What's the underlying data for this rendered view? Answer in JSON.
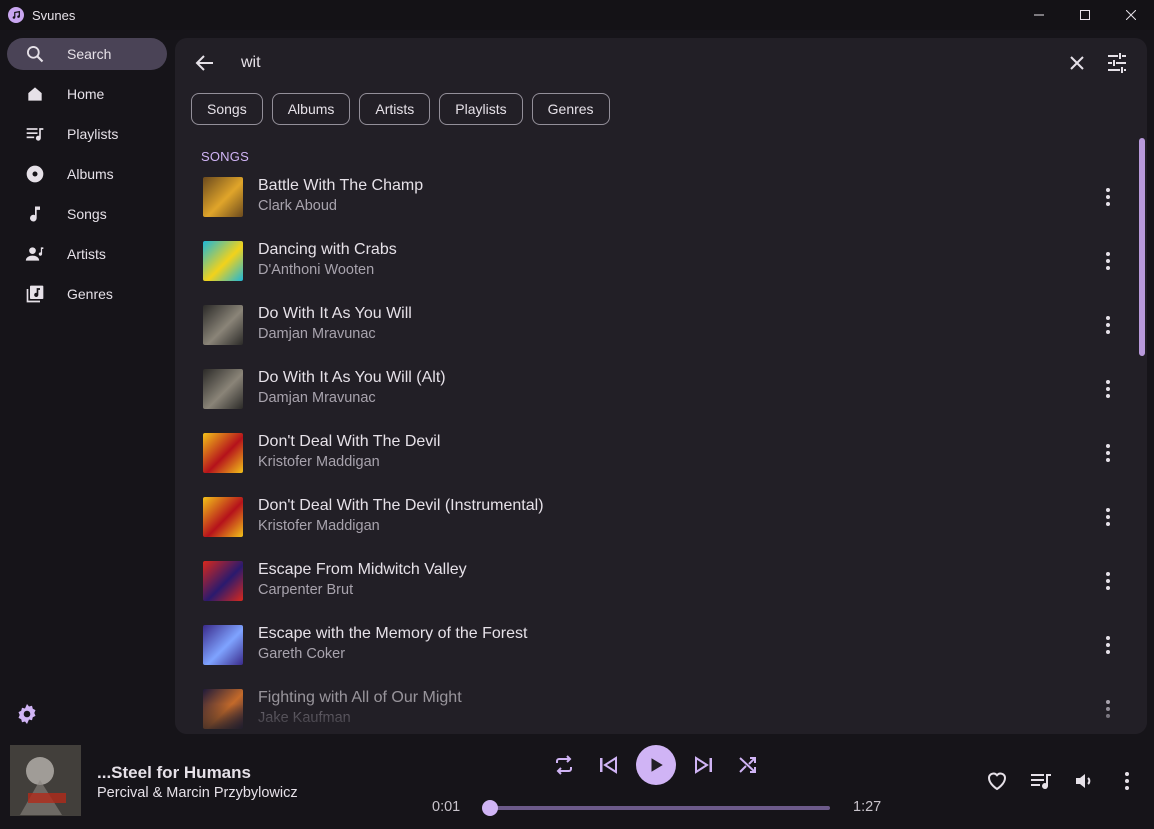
{
  "window": {
    "title": "Svunes"
  },
  "sidebar": {
    "items": [
      {
        "label": "Search",
        "icon": "search-icon",
        "active": true
      },
      {
        "label": "Home",
        "icon": "home-icon"
      },
      {
        "label": "Playlists",
        "icon": "playlist-icon"
      },
      {
        "label": "Albums",
        "icon": "album-icon"
      },
      {
        "label": "Songs",
        "icon": "music-note-icon"
      },
      {
        "label": "Artists",
        "icon": "artist-icon"
      },
      {
        "label": "Genres",
        "icon": "genre-icon"
      }
    ]
  },
  "search": {
    "query": "wit"
  },
  "filters": [
    "Songs",
    "Albums",
    "Artists",
    "Playlists",
    "Genres"
  ],
  "section_label": "SONGS",
  "songs": [
    {
      "title": "Battle With The Champ",
      "artist": "Clark Aboud",
      "art": [
        "#6b4a1e",
        "#e0a52a"
      ]
    },
    {
      "title": "Dancing with Crabs",
      "artist": "D'Anthoni Wooten",
      "art": [
        "#1db7d9",
        "#f2d21b"
      ]
    },
    {
      "title": "Do With It As You Will",
      "artist": "Damjan Mravunac",
      "art": [
        "#2b2a28",
        "#8a8478"
      ]
    },
    {
      "title": "Do With It As You Will (Alt)",
      "artist": "Damjan Mravunac",
      "art": [
        "#2b2a28",
        "#8a8478"
      ]
    },
    {
      "title": "Don't Deal With The Devil",
      "artist": "Kristofer Maddigan",
      "art": [
        "#f3c21a",
        "#b5121b"
      ]
    },
    {
      "title": "Don't Deal With The Devil (Instrumental)",
      "artist": "Kristofer Maddigan",
      "art": [
        "#f3c21a",
        "#b5121b"
      ]
    },
    {
      "title": "Escape From Midwitch Valley",
      "artist": "Carpenter Brut",
      "art": [
        "#d9281c",
        "#2a1a6e"
      ]
    },
    {
      "title": "Escape with the Memory of the Forest",
      "artist": "Gareth Coker",
      "art": [
        "#3a2a8a",
        "#7fa3ff"
      ]
    },
    {
      "title": "Fighting with All of Our Might",
      "artist": "Jake Kaufman",
      "art": [
        "#1e1a3a",
        "#c46a2a"
      ]
    }
  ],
  "now_playing": {
    "title": "...Steel for Humans",
    "artist": "Percival & Marcin Przybylowicz",
    "elapsed": "0:01",
    "duration": "1:27",
    "progress": 0.011
  },
  "colors": {
    "accent": "#d0b4f5",
    "panel": "#221f26",
    "background": "#161419",
    "active_nav": "#4a4356"
  }
}
